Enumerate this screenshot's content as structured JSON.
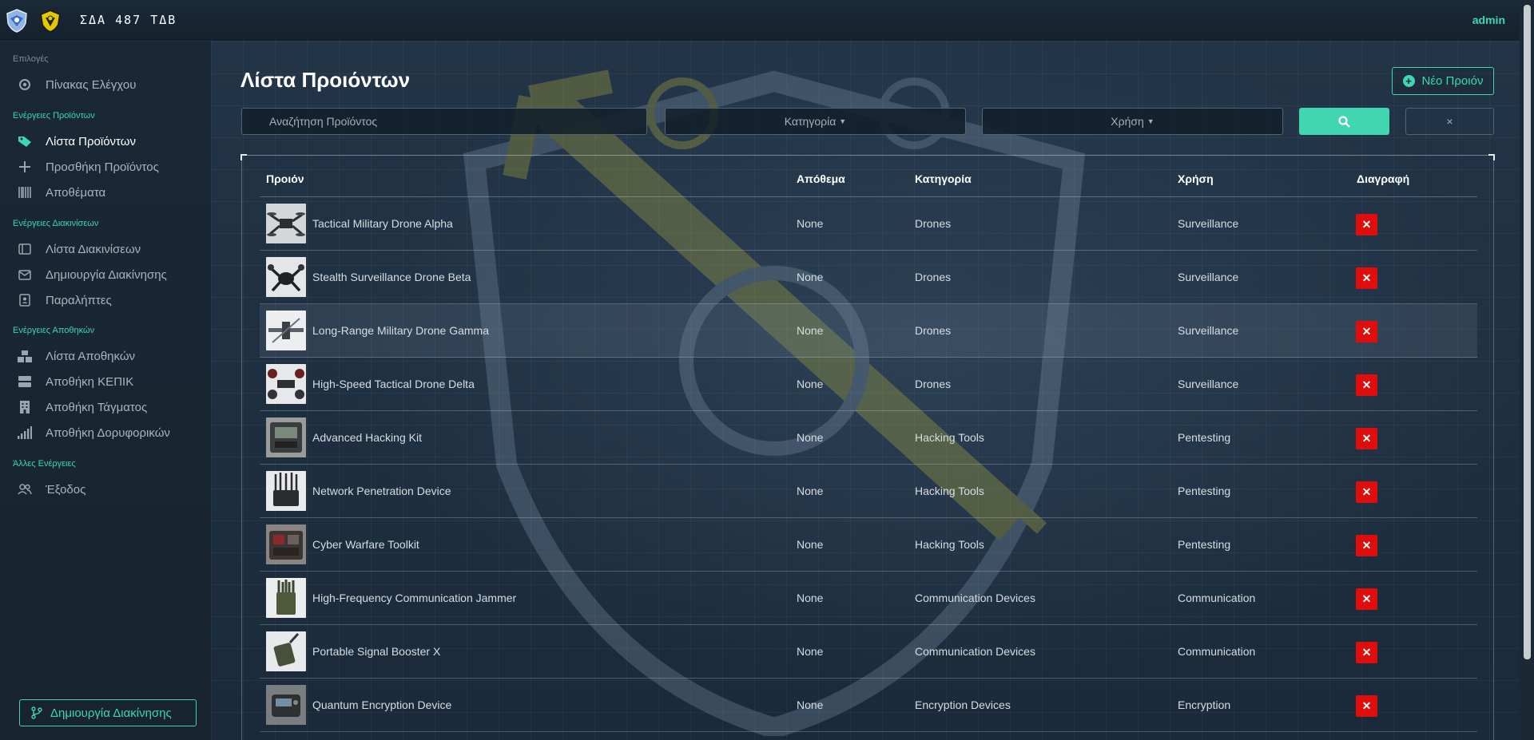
{
  "topbar": {
    "brand": "ΣΔΑ 487 ΤΔΒ",
    "user": "admin"
  },
  "sidebar": {
    "sections": [
      {
        "label": "Επιλογές",
        "items": [
          {
            "label": "Πίνακας Ελέγχου",
            "icon": "gear-icon"
          }
        ]
      },
      {
        "label": "Ενέργειες Προϊόντων",
        "items": [
          {
            "label": "Λίστα Προϊόντων",
            "icon": "tag-icon",
            "active": true
          },
          {
            "label": "Προσθήκη Προϊόντος",
            "icon": "plus-icon"
          },
          {
            "label": "Αποθέματα",
            "icon": "barcode-icon"
          }
        ]
      },
      {
        "label": "Ενέργειες Διακινίσεων",
        "items": [
          {
            "label": "Λίστα Διακινίσεων",
            "icon": "sidebar-panel-icon"
          },
          {
            "label": "Δημιουργία Διακίνησης",
            "icon": "envelope-icon"
          },
          {
            "label": "Παραλήπτες",
            "icon": "contact-card-icon"
          }
        ]
      },
      {
        "label": "Ενέργειες Αποθηκών",
        "items": [
          {
            "label": "Λίστα Αποθηκών",
            "icon": "boxes-icon"
          },
          {
            "label": "Αποθήκη ΚΕΠΙΚ",
            "icon": "server-icon"
          },
          {
            "label": "Αποθήκη Τάγματος",
            "icon": "building-icon"
          },
          {
            "label": "Αποθήκη Δορυφορικών",
            "icon": "signal-bars-icon"
          }
        ]
      },
      {
        "label": "Άλλες Ενέργειες",
        "items": [
          {
            "label": "Έξοδος",
            "icon": "users-icon"
          }
        ]
      }
    ],
    "bottom_button": "Δημιουργία Διακίνησης"
  },
  "main": {
    "title": "Λίστα Προιόντων",
    "new_button": "Νέο Προιόν",
    "search_placeholder": "Αναζήτηση Προϊόντος",
    "category_select": "Κατηγορία",
    "usage_select": "Χρήση",
    "clear_label": "×",
    "table": {
      "headers": [
        "Προιόν",
        "Απόθεμα",
        "Κατηγορία",
        "Χρήση",
        "Διαγραφή"
      ],
      "rows": [
        {
          "name": "Tactical Military Drone Alpha",
          "stock": "None",
          "category": "Drones",
          "usage": "Surveillance"
        },
        {
          "name": "Stealth Surveillance Drone Beta",
          "stock": "None",
          "category": "Drones",
          "usage": "Surveillance"
        },
        {
          "name": "Long-Range Military Drone Gamma",
          "stock": "None",
          "category": "Drones",
          "usage": "Surveillance"
        },
        {
          "name": "High-Speed Tactical Drone Delta",
          "stock": "None",
          "category": "Drones",
          "usage": "Surveillance"
        },
        {
          "name": "Advanced Hacking Kit",
          "stock": "None",
          "category": "Hacking Tools",
          "usage": "Pentesting"
        },
        {
          "name": "Network Penetration Device",
          "stock": "None",
          "category": "Hacking Tools",
          "usage": "Pentesting"
        },
        {
          "name": "Cyber Warfare Toolkit",
          "stock": "None",
          "category": "Hacking Tools",
          "usage": "Pentesting"
        },
        {
          "name": "High-Frequency Communication Jammer",
          "stock": "None",
          "category": "Communication Devices",
          "usage": "Communication"
        },
        {
          "name": "Portable Signal Booster X",
          "stock": "None",
          "category": "Communication Devices",
          "usage": "Communication"
        },
        {
          "name": "Quantum Encryption Device",
          "stock": "None",
          "category": "Encryption Devices",
          "usage": "Encryption"
        }
      ],
      "delete_label": "✕"
    }
  },
  "colors": {
    "accent": "#3fd6b0",
    "delete": "#e00d0d",
    "background": "#1b2a3a"
  }
}
